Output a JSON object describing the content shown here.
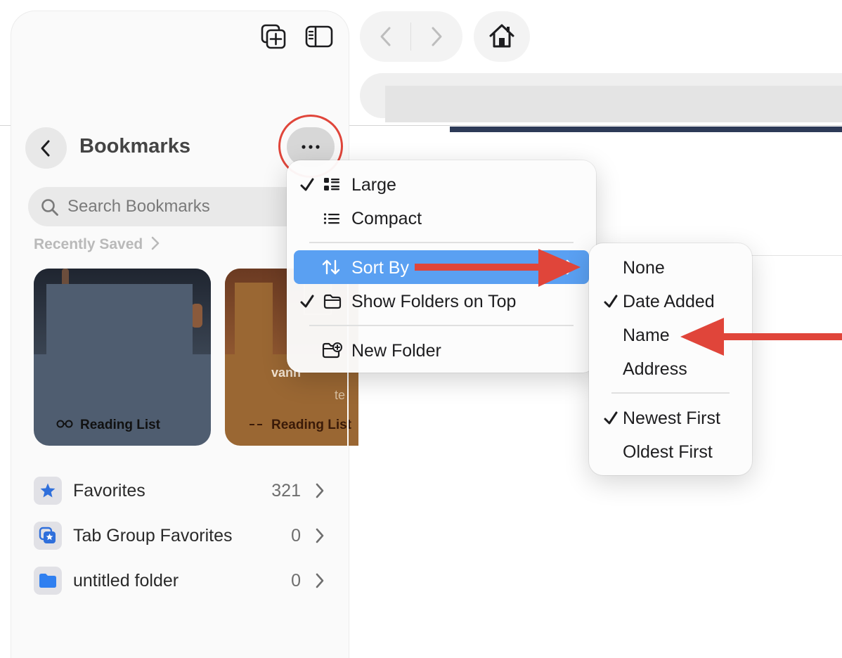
{
  "sidebar": {
    "title": "Bookmarks",
    "search_placeholder": "Search Bookmarks",
    "recently_saved": "Recently Saved",
    "cards": [
      {
        "label": "Reading List"
      },
      {
        "label": "Reading List"
      }
    ],
    "card2_fragments": [
      "vann",
      "te"
    ],
    "folders": [
      {
        "label": "Favorites",
        "count": "321",
        "icon": "star-icon"
      },
      {
        "label": "Tab Group Favorites",
        "count": "0",
        "icon": "tab-group-star-icon"
      },
      {
        "label": "untitled folder",
        "count": "0",
        "icon": "folder-icon"
      }
    ]
  },
  "menu": {
    "large": "Large",
    "compact": "Compact",
    "sort_by": "Sort By",
    "show_folders_on_top": "Show Folders on Top",
    "new_folder": "New Folder"
  },
  "submenu": {
    "items": [
      "None",
      "Date Added",
      "Name",
      "Address"
    ],
    "order_items": [
      "Newest First",
      "Oldest First"
    ]
  },
  "colors": {
    "accent": "#5aa0f2",
    "annotation": "#e0453a",
    "star": "#2f6fdb"
  }
}
